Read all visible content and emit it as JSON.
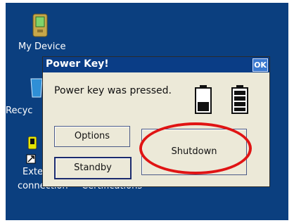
{
  "desktop": {
    "icons": [
      {
        "label": "My Device"
      },
      {
        "label": "Recyc"
      },
      {
        "label": "Exte"
      },
      {
        "label": "connection"
      },
      {
        "label": "Certifications"
      }
    ]
  },
  "dialog": {
    "title": "Power Key!",
    "ok_label": "OK",
    "message": "Power key was pressed.",
    "buttons": {
      "options": "Options",
      "standby": "Standby",
      "shutdown": "Shutdown"
    }
  }
}
